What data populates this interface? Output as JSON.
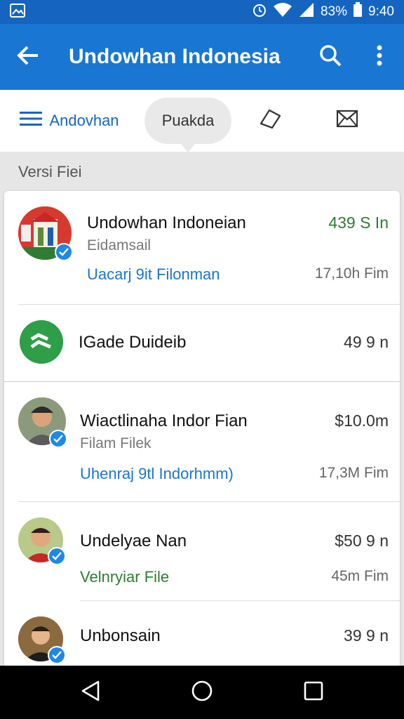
{
  "status_bar": {
    "battery": "83%",
    "time": "9:40",
    "icons": [
      "image-icon",
      "alarm-icon",
      "wifi-icon",
      "signal-icon",
      "battery-icon"
    ]
  },
  "app_bar": {
    "title": "Undowhan Indonesia",
    "color": "#1976d2"
  },
  "tabs": {
    "menu_label": "Andovhan",
    "active_label": "Puakda"
  },
  "section_label": "Versi Fiei",
  "items": [
    {
      "name": "Undowhan Indoneian",
      "subtitle": "Eidamsail",
      "link": "Uacarj 9it Filonman",
      "amount": "439 S In",
      "meta": "17,10h Fim"
    },
    {
      "name": "IGade Duideib",
      "amount": "49 9 n"
    },
    {
      "name": "Wiactlinaha Indor Fian",
      "subtitle": "Filam Filek",
      "link": "Uhenraj 9tl Indorhmm)",
      "amount": "$10.0m",
      "meta": "17,3M Fim"
    },
    {
      "name": "Undelyae Nan",
      "link": "Velnryiar File",
      "amount": "$50 9 n",
      "meta": "45m Fim"
    },
    {
      "name": "Unbonsain",
      "amount": "39 9 n"
    }
  ],
  "colors": {
    "primary": "#1976d2",
    "green": "#2e7d32",
    "verified": "#1e88e5"
  }
}
